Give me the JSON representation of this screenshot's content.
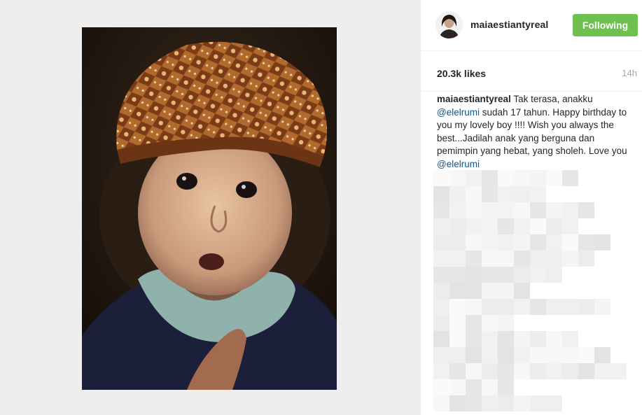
{
  "header": {
    "username": "maiaestiantyreal",
    "follow_label": "Following"
  },
  "stats": {
    "likes": "20.3k likes",
    "time": "14h"
  },
  "caption": {
    "username": "maiaestiantyreal",
    "text_1": " Tak terasa, anakku ",
    "mention_1": "@elelrumi",
    "text_2": " sudah 17 tahun. Happy birthday to you my lovely boy !!!! Wish you always the best...Jadilah anak yang berguna dan pemimpin yang hebat, yang sholeh. Love you ",
    "mention_2": "@elelrumi"
  },
  "colors": {
    "follow_button": "#70c050",
    "mention": "#125688",
    "media_background": "#efeeee"
  },
  "icons": {
    "avatar": "profile-photo"
  }
}
